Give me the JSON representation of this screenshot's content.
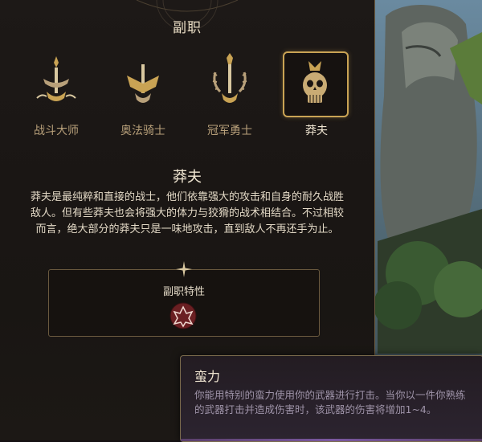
{
  "panel": {
    "title": "副职"
  },
  "subclasses": [
    {
      "label": "战斗大师",
      "icon": "battle-master-icon",
      "selected": false
    },
    {
      "label": "奥法骑士",
      "icon": "eldritch-knight-icon",
      "selected": false
    },
    {
      "label": "冠军勇士",
      "icon": "champion-icon",
      "selected": false
    },
    {
      "label": "莽夫",
      "icon": "berserker-skull-icon",
      "selected": true
    }
  ],
  "detail": {
    "title": "莽夫",
    "description": "莽夫是最纯粹和直接的战士，他们依靠强大的攻击和自身的耐久战胜敌人。但有些莽夫也会将强大的体力与狡猾的战术相结合。不过相较而言，绝大部分的莽夫只是一味地攻击，直到敌人不再还手为止。",
    "feature_label": "副职特性",
    "feature_icon": "brute-force-icon"
  },
  "tooltip": {
    "title": "蛮力",
    "description": "你能用特别的蛮力使用你的武器进行打击。当你以一件你熟练的武器打击并造成伤害时，该武器的伤害将增加1~4。"
  },
  "colors": {
    "gold": "#c9a354",
    "label": "#b8a07a",
    "text": "#e3d9c6"
  }
}
